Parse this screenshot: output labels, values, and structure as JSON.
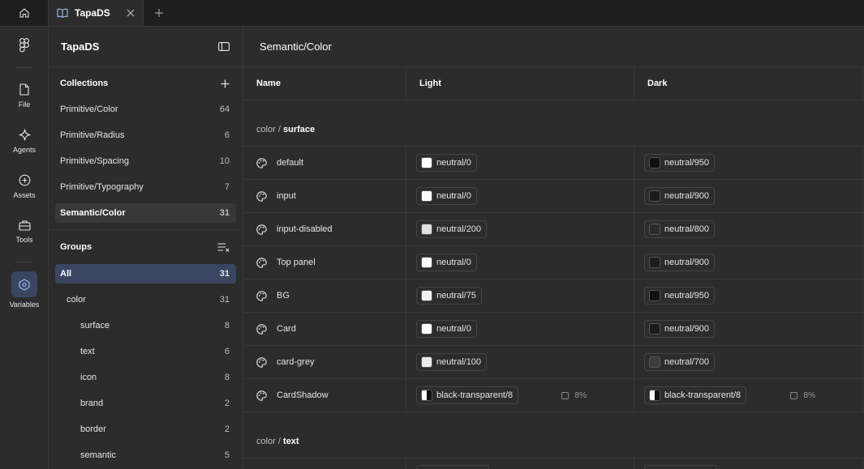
{
  "tabs": [
    {
      "label": "TapaDS"
    }
  ],
  "rail": {
    "items": [
      {
        "label": "File"
      },
      {
        "label": "Agents"
      },
      {
        "label": "Assets"
      },
      {
        "label": "Tools"
      },
      {
        "label": "Variables"
      }
    ]
  },
  "sidebar": {
    "title": "TapaDS",
    "collections_title": "Collections",
    "collections": [
      {
        "label": "Primitive/Color",
        "count": "64"
      },
      {
        "label": "Primitive/Radius",
        "count": "6"
      },
      {
        "label": "Primitive/Spacing",
        "count": "10"
      },
      {
        "label": "Primitive/Typography",
        "count": "7"
      },
      {
        "label": "Semantic/Color",
        "count": "31"
      }
    ],
    "groups_title": "Groups",
    "groups": [
      {
        "label": "All",
        "count": "31"
      },
      {
        "label": "color",
        "count": "31"
      },
      {
        "label": "surface",
        "count": "8"
      },
      {
        "label": "text",
        "count": "6"
      },
      {
        "label": "icon",
        "count": "8"
      },
      {
        "label": "brand",
        "count": "2"
      },
      {
        "label": "border",
        "count": "2"
      },
      {
        "label": "semantic",
        "count": "5"
      }
    ]
  },
  "main": {
    "title": "Semantic/Color",
    "columns": {
      "name": "Name",
      "light": "Light",
      "dark": "Dark"
    },
    "group1": {
      "prefix": "color / ",
      "name": "surface"
    },
    "group2": {
      "prefix": "color / ",
      "name": "text"
    },
    "rows": [
      {
        "name": "default",
        "light": "neutral/0",
        "light_color": "#ffffff",
        "dark": "neutral/950",
        "dark_color": "#111111"
      },
      {
        "name": "input",
        "light": "neutral/0",
        "light_color": "#ffffff",
        "dark": "neutral/900",
        "dark_color": "#1c1c1c"
      },
      {
        "name": "input-disabled",
        "light": "neutral/200",
        "light_color": "#e0e0e0",
        "dark": "neutral/800",
        "dark_color": "#2a2a2a"
      },
      {
        "name": "Top panel",
        "light": "neutral/0",
        "light_color": "#ffffff",
        "dark": "neutral/900",
        "dark_color": "#1c1c1c"
      },
      {
        "name": "BG",
        "light": "neutral/75",
        "light_color": "#f2f2f2",
        "dark": "neutral/950",
        "dark_color": "#111111"
      },
      {
        "name": "Card",
        "light": "neutral/0",
        "light_color": "#ffffff",
        "dark": "neutral/900",
        "dark_color": "#1c1c1c"
      },
      {
        "name": "card-grey",
        "light": "neutral/100",
        "light_color": "#ebebeb",
        "dark": "neutral/700",
        "dark_color": "#3d3d3d"
      },
      {
        "name": "CardShadow",
        "light": "black-transparent/8",
        "light_pct": "8%",
        "dark": "black-transparent/8",
        "dark_pct": "8%"
      }
    ]
  }
}
